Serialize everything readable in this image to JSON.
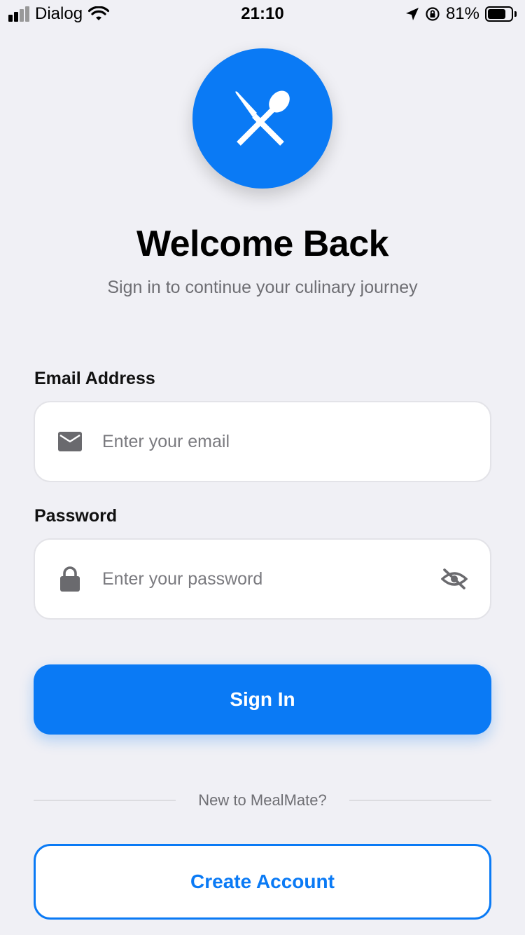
{
  "status_bar": {
    "carrier": "Dialog",
    "time": "21:10",
    "battery_percent": "81%",
    "battery_level": 0.81,
    "icons": [
      "signal-icon",
      "wifi-icon",
      "location-arrow-icon",
      "orientation-lock-icon",
      "battery-charging-icon"
    ]
  },
  "header": {
    "logo_icon": "fork-knife-crossed-icon",
    "title": "Welcome Back",
    "subtitle": "Sign in to continue your culinary journey"
  },
  "form": {
    "email": {
      "label": "Email Address",
      "placeholder": "Enter your email",
      "value": "",
      "icon": "envelope-icon"
    },
    "password": {
      "label": "Password",
      "placeholder": "Enter your password",
      "value": "",
      "icon": "lock-icon",
      "toggle_icon": "eye-slash-icon"
    },
    "submit_label": "Sign In"
  },
  "footer": {
    "divider_text": "New to MealMate?",
    "create_account_label": "Create Account"
  },
  "colors": {
    "accent": "#0A7AF5",
    "background": "#F0F0F5",
    "secondary_text": "#6E6E73",
    "input_border": "#E3E3E8"
  }
}
